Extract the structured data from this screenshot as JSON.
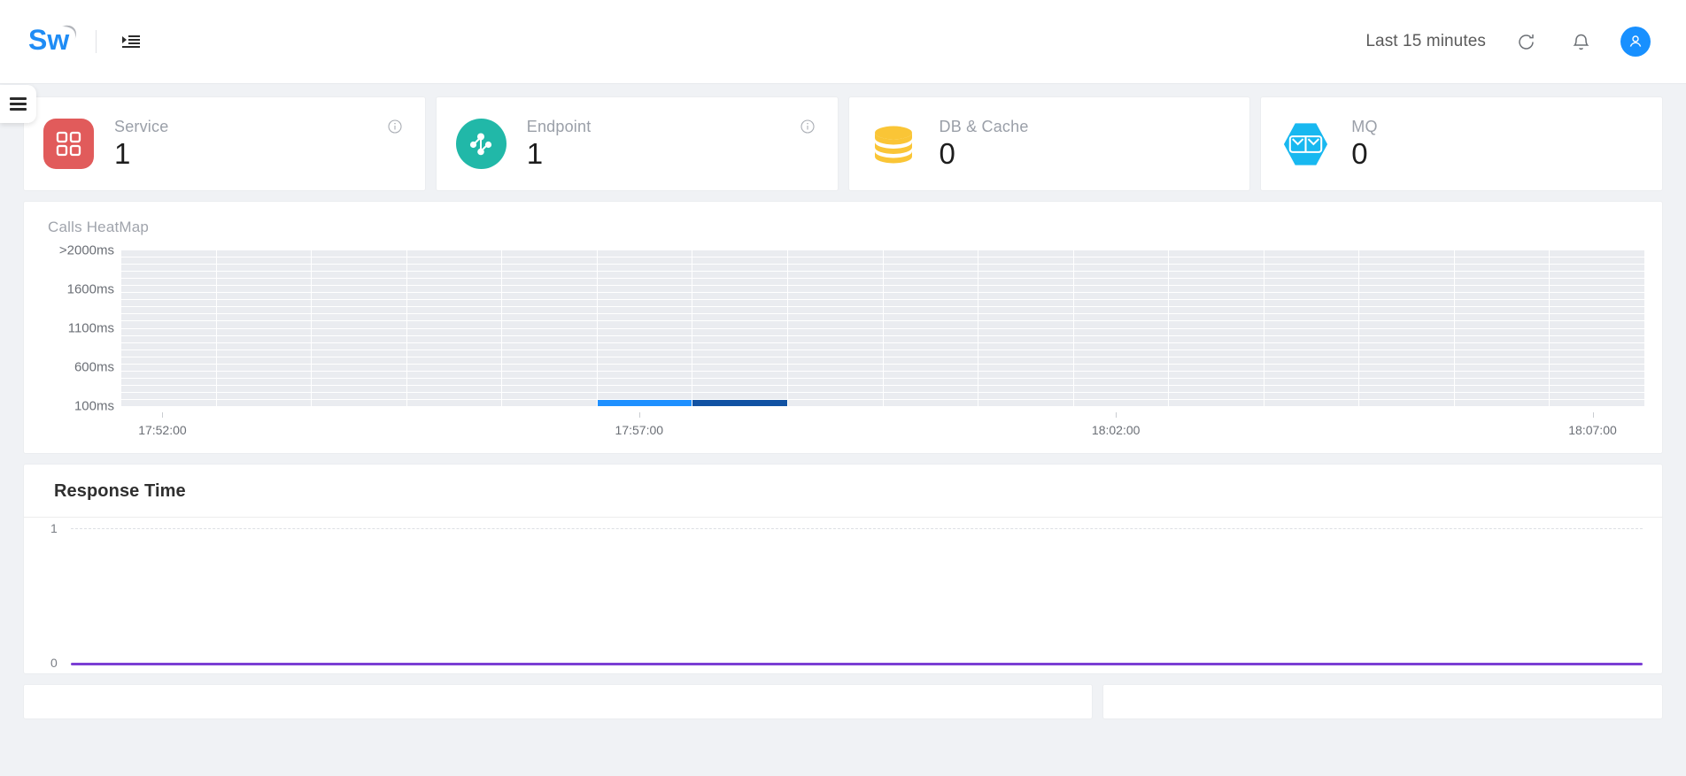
{
  "app": {
    "logo_text": "Sw",
    "menu_toggle_name": "indent-list-icon",
    "sidebar_toggle_name": "hamburger-menu-icon"
  },
  "topbar": {
    "time_range": "Last 15 minutes",
    "refresh_icon": "refresh-icon",
    "notification_icon": "bell-icon",
    "avatar_icon": "user-avatar-icon"
  },
  "metrics": [
    {
      "label": "Service",
      "value": "1",
      "icon": "grid-squares-icon",
      "color": "#e15b5b",
      "has_info": true
    },
    {
      "label": "Endpoint",
      "value": "1",
      "icon": "node-graph-icon",
      "color": "#21b8a8",
      "has_info": true
    },
    {
      "label": "DB & Cache",
      "value": "0",
      "icon": "database-icon",
      "color": "#fac536",
      "has_info": false
    },
    {
      "label": "MQ",
      "value": "0",
      "icon": "message-queue-icon",
      "color": "#18b8f0",
      "has_info": false
    }
  ],
  "heatmap": {
    "title": "Calls HeatMap",
    "chart_data": {
      "type": "heatmap",
      "title": "Calls HeatMap",
      "xlabel": "",
      "ylabel": "",
      "y_ticks": [
        "100ms",
        "600ms",
        "1100ms",
        "1600ms",
        ">2000ms"
      ],
      "x_ticks": [
        "17:52:00",
        "17:57:00",
        "18:02:00",
        "18:07:00"
      ],
      "x_tick_positions_pct": [
        2.7,
        34.0,
        65.3,
        96.6
      ],
      "columns": 16,
      "rows": 22,
      "empty_cell_color": "#eaecf0",
      "cells": [
        {
          "col": 5,
          "row": 21,
          "value": 1,
          "color": "#1e90ff"
        },
        {
          "col": 6,
          "row": 21,
          "value": 3,
          "color": "#1152a3"
        }
      ],
      "grid": true,
      "legend": "none"
    }
  },
  "response_time": {
    "title": "Response Time",
    "chart_data": {
      "type": "line",
      "title": "Response Time",
      "xlabel": "",
      "ylabel": "",
      "ylim": [
        0,
        1
      ],
      "y_ticks": [
        "0",
        "1"
      ],
      "grid": true,
      "legend": "none",
      "series": [
        {
          "name": "Response Time",
          "color": "#7b3fd4",
          "values": [
            0,
            0,
            0,
            0,
            0,
            0,
            0,
            0,
            0,
            0,
            0,
            0,
            0,
            0,
            0,
            0
          ]
        }
      ]
    }
  },
  "colors": {
    "page_background": "#f0f2f5",
    "panel_background": "#ffffff",
    "accent_blue": "#1890ff",
    "heat_low": "#1e90ff",
    "heat_high": "#1152a3",
    "series_purple": "#7b3fd4"
  }
}
